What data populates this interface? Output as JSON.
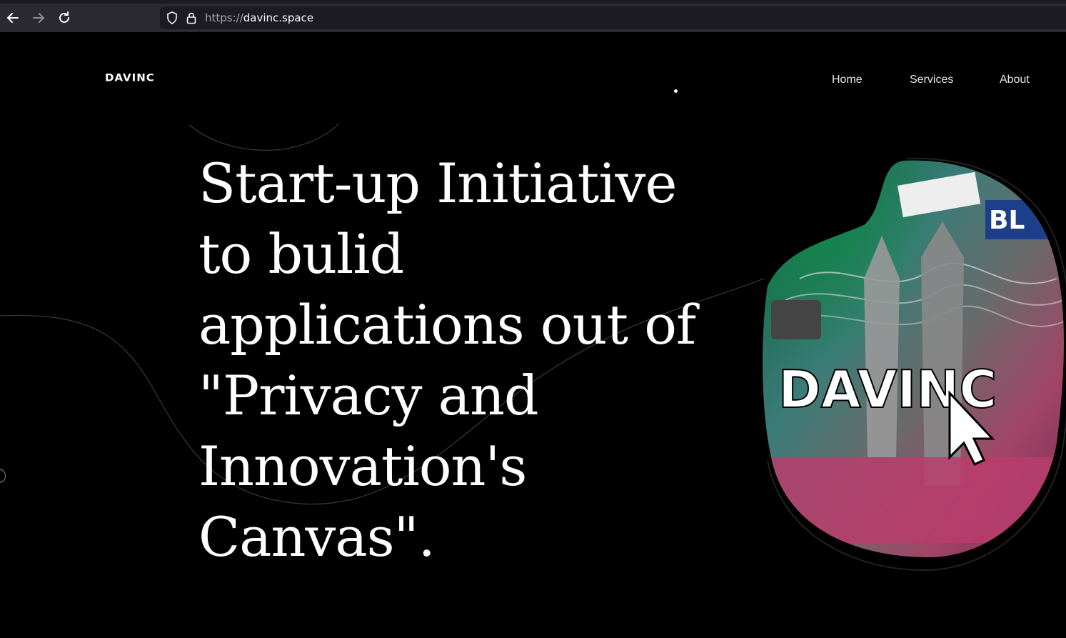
{
  "browser": {
    "url_scheme": "https://",
    "url_host": "davinc.space",
    "back_icon": "arrow-left-icon",
    "forward_icon": "arrow-right-icon",
    "reload_icon": "reload-icon",
    "shield_icon": "shield-icon",
    "lock_icon": "lock-icon"
  },
  "site": {
    "logo": "DAVINC",
    "nav": [
      {
        "label": "Home"
      },
      {
        "label": "Services"
      },
      {
        "label": "About"
      }
    ],
    "headline": "Start-up Initiative to bulid applications out of \"Privacy and Innovation's Canvas\".",
    "hero_image": {
      "wordmark": "DAVINC",
      "description_icon": "collage-image"
    }
  },
  "colors": {
    "background": "#000000",
    "toolbar": "#2b2a33",
    "urlbar": "#1c1b22",
    "text": "#ffffff"
  }
}
